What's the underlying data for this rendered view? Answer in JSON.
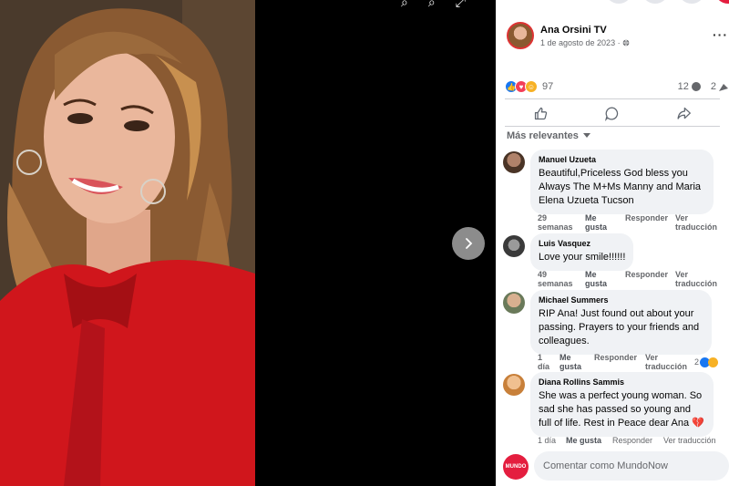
{
  "viewer": {
    "next_icon": "chevron-right-icon",
    "top_icons": [
      "zoom-in-icon",
      "zoom-out-icon",
      "fullscreen-icon"
    ]
  },
  "post": {
    "page_name": "Ana Orsini TV",
    "date": "1 de agosto de 2023",
    "audience_icon": "globe-icon",
    "more_icon": "more-dots-icon"
  },
  "stats": {
    "reactions_count": "97",
    "comments_count": "12",
    "shares_count": "2"
  },
  "actions": {
    "like_icon": "thumbs-up-icon",
    "comment_icon": "comment-bubble-icon",
    "share_icon": "share-arrow-icon"
  },
  "sort": {
    "label": "Más relevantes"
  },
  "comments": [
    {
      "author": "Manuel Uzueta",
      "text": "Beautiful,Priceless God bless you Always The M+Ms Manny and Maria Elena Uzueta Tucson",
      "time_line1": "29",
      "time_line2": "semanas",
      "like_line1": "Me",
      "like_line2": "gusta",
      "reply": "Responder",
      "translate_line1": "Ver",
      "translate_line2": "traducción"
    },
    {
      "author": "Luis Vasquez",
      "text": "Love your smile!!!!!!",
      "time_line1": "49",
      "time_line2": "semanas",
      "like_line1": "Me",
      "like_line2": "gusta",
      "reply": "Responder",
      "translate_line1": "Ver",
      "translate_line2": "traducción"
    },
    {
      "author": "Michael Summers",
      "text": "RIP Ana! Just found out about your passing. Prayers to your friends and colleagues.",
      "time_line1": "1",
      "time_line2": "día",
      "like_line1": "Me",
      "like_line2": "gusta",
      "reply": "Responder",
      "translate_line1": "Ver",
      "translate_line2": "traducción",
      "reaction_count": "2"
    },
    {
      "author": "Diana Rollins Sammis",
      "text": "She was a perfect young woman. So sad she has passed so young and full of life. Rest in Peace dear Ana",
      "emoji": "💔",
      "time": "1 día",
      "like": "Me gusta",
      "reply": "Responder",
      "translate": "Ver traducción"
    }
  ],
  "composer": {
    "avatar_label": "MUNDO",
    "placeholder": "Comentar como MundoNow"
  },
  "colors": {
    "accent": "#1877f2",
    "panel_bg": "#ffffff",
    "bubble_bg": "#f0f2f5",
    "muted_text": "#65676b"
  }
}
